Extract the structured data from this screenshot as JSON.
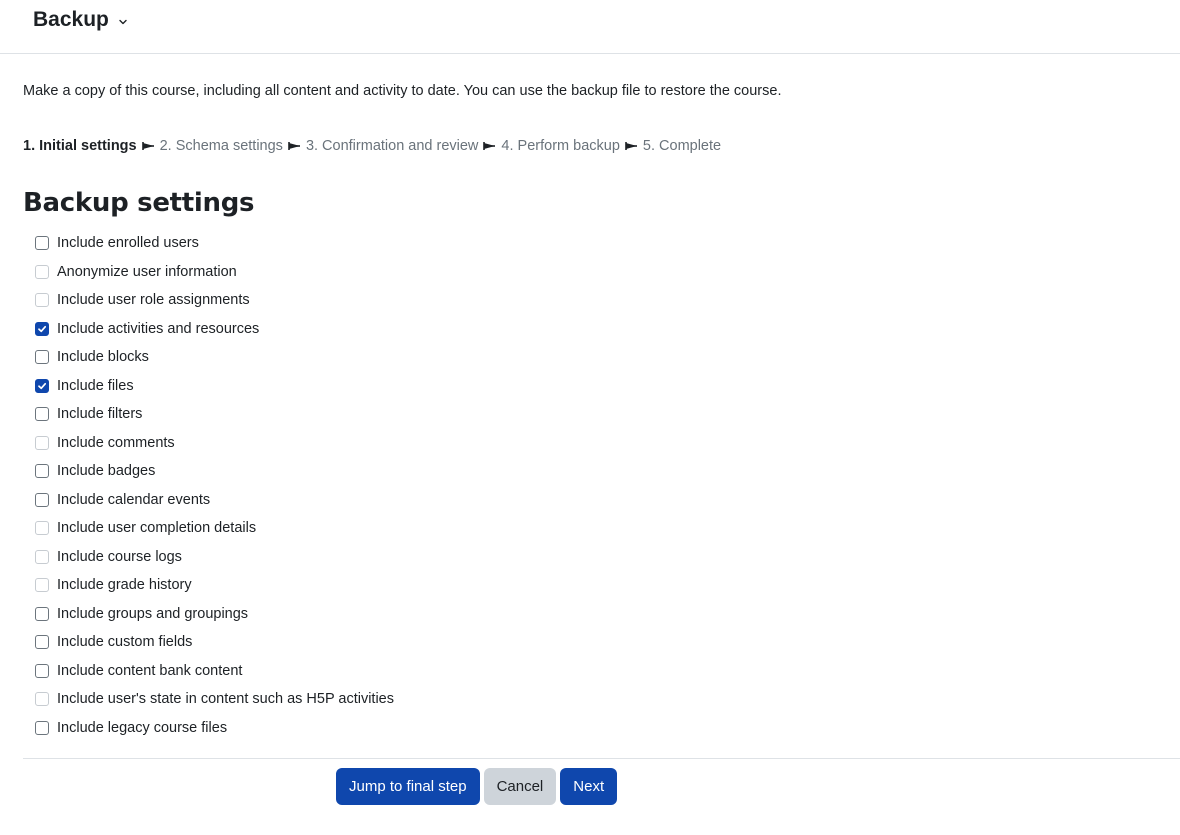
{
  "header": {
    "title": "Backup"
  },
  "intro_text": "Make a copy of this course, including all content and activity to date. You can use the backup file to restore the course.",
  "steps": [
    {
      "label": "1. Initial settings",
      "current": true
    },
    {
      "label": "2. Schema settings",
      "current": false
    },
    {
      "label": "3. Confirmation and review",
      "current": false
    },
    {
      "label": "4. Perform backup",
      "current": false
    },
    {
      "label": "5. Complete",
      "current": false
    }
  ],
  "section_title": "Backup settings",
  "options": [
    {
      "label": "Include enrolled users",
      "checked": false,
      "disabled": false
    },
    {
      "label": "Anonymize user information",
      "checked": false,
      "disabled": true
    },
    {
      "label": "Include user role assignments",
      "checked": false,
      "disabled": true
    },
    {
      "label": "Include activities and resources",
      "checked": true,
      "disabled": false
    },
    {
      "label": "Include blocks",
      "checked": false,
      "disabled": false
    },
    {
      "label": "Include files",
      "checked": true,
      "disabled": false
    },
    {
      "label": "Include filters",
      "checked": false,
      "disabled": false
    },
    {
      "label": "Include comments",
      "checked": false,
      "disabled": true
    },
    {
      "label": "Include badges",
      "checked": false,
      "disabled": false
    },
    {
      "label": "Include calendar events",
      "checked": false,
      "disabled": false
    },
    {
      "label": "Include user completion details",
      "checked": false,
      "disabled": true
    },
    {
      "label": "Include course logs",
      "checked": false,
      "disabled": true
    },
    {
      "label": "Include grade history",
      "checked": false,
      "disabled": true
    },
    {
      "label": "Include groups and groupings",
      "checked": false,
      "disabled": false
    },
    {
      "label": "Include custom fields",
      "checked": false,
      "disabled": false
    },
    {
      "label": "Include content bank content",
      "checked": false,
      "disabled": false
    },
    {
      "label": "Include user's state in content such as H5P activities",
      "checked": false,
      "disabled": true
    },
    {
      "label": "Include legacy course files",
      "checked": false,
      "disabled": false
    }
  ],
  "buttons": {
    "jump": "Jump to final step",
    "cancel": "Cancel",
    "next": "Next"
  },
  "colors": {
    "primary": "#0f47ad",
    "secondary": "#ced4da",
    "text": "#1d2125"
  }
}
